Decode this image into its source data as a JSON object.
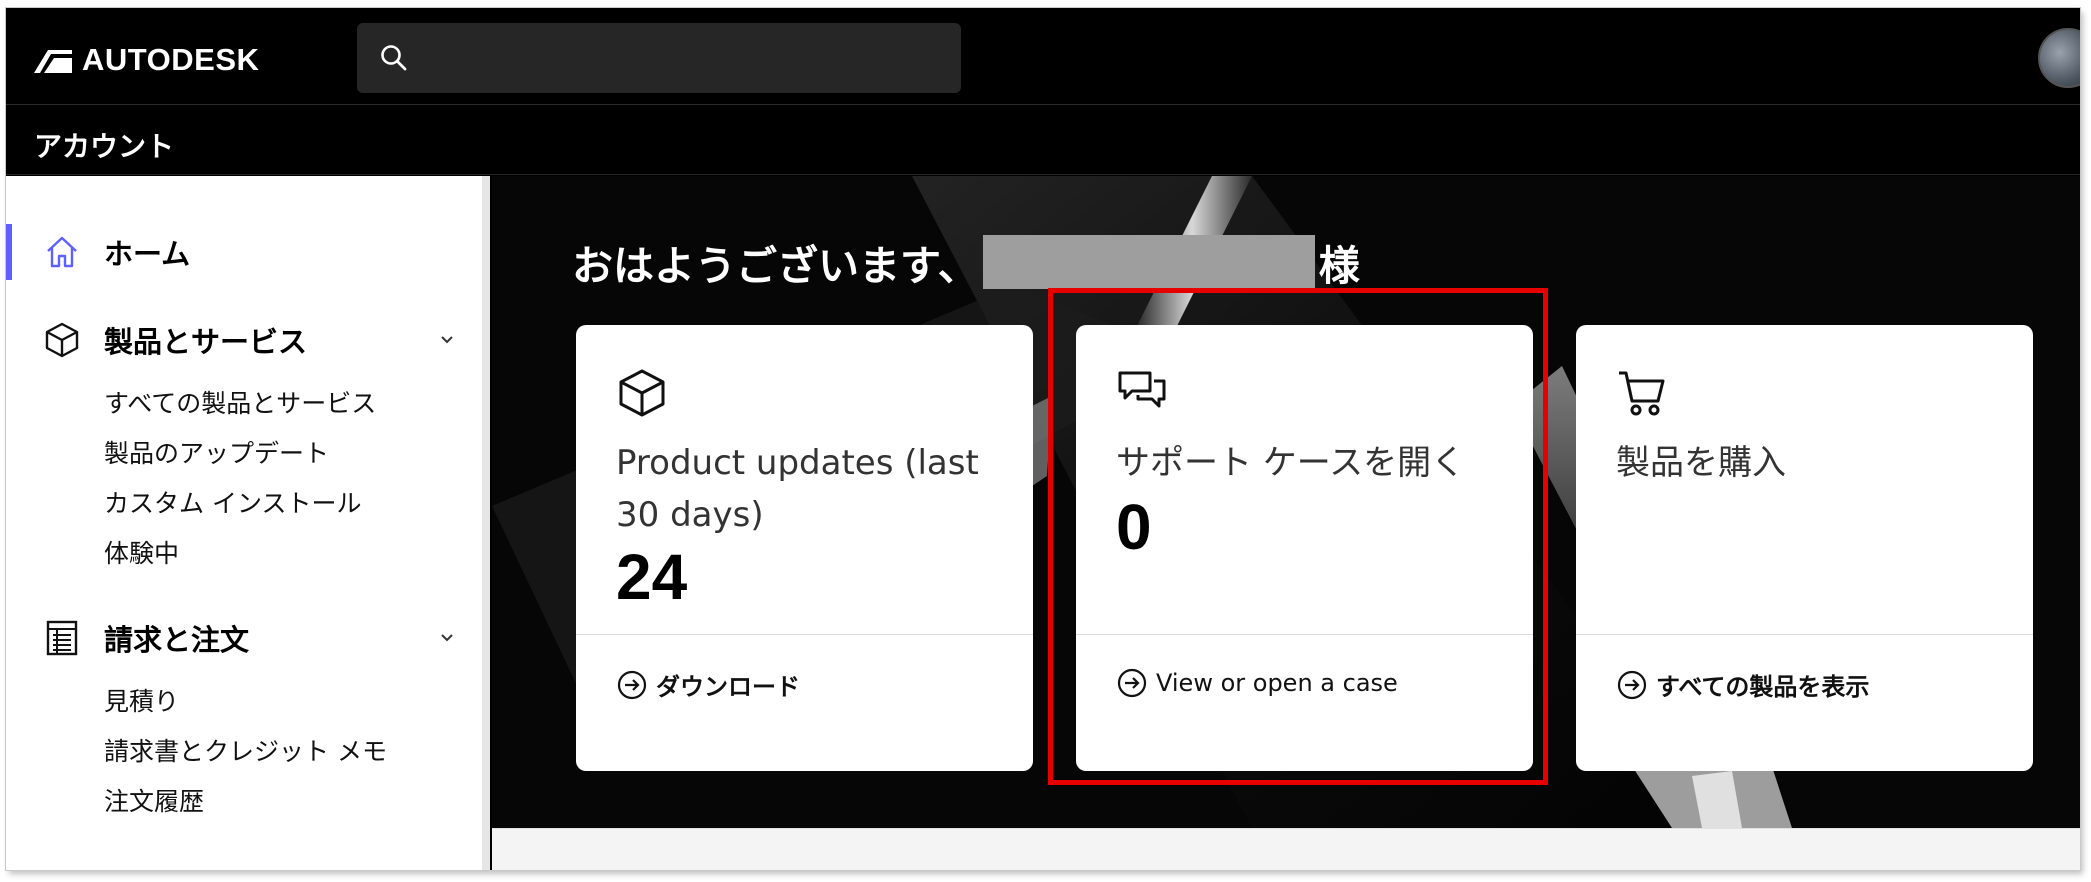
{
  "header": {
    "brand": "AUTODESK",
    "search_placeholder": "",
    "section_title": "アカウント"
  },
  "sidebar": {
    "items": [
      {
        "label": "ホーム",
        "icon": "home-icon",
        "active": true,
        "subitems": []
      },
      {
        "label": "製品とサービス",
        "icon": "cube-icon",
        "expandable": true,
        "subitems": [
          "すべての製品とサービス",
          "製品のアップデート",
          "カスタム インストール",
          "体験中"
        ]
      },
      {
        "label": "請求と注文",
        "icon": "receipt-icon",
        "expandable": true,
        "subitems": [
          "見積り",
          "請求書とクレジット メモ",
          "注文履歴"
        ]
      }
    ],
    "active_color": "#5f60ff"
  },
  "hero": {
    "greeting_prefix": "おはようございます、",
    "greeting_suffix": "様"
  },
  "cards": [
    {
      "icon": "cube-icon",
      "title": "Product updates (last 30 days)",
      "value": "24",
      "link": "ダウンロード",
      "link_icon": "arrow-circle-icon"
    },
    {
      "icon": "chat-bubbles-icon",
      "title": "サポート ケースを開く",
      "value": "0",
      "link": "View or open a case",
      "link_icon": "arrow-circle-icon"
    },
    {
      "icon": "cart-icon",
      "title": "製品を購入",
      "value": "",
      "link": "すべての製品を表示",
      "link_icon": "arrow-circle-icon"
    }
  ],
  "annotation": {
    "highlight_color": "#e60000"
  }
}
